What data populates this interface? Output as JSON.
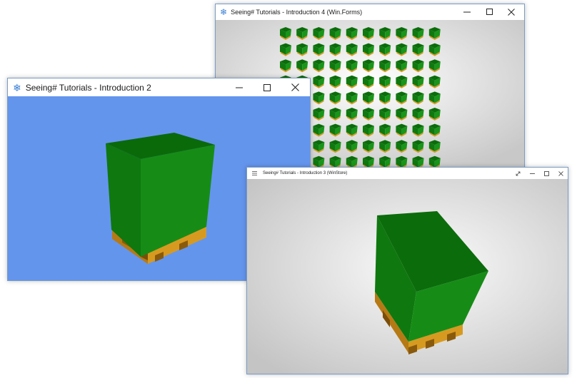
{
  "windows": {
    "winforms": {
      "title": "Seeing# Tutorials - Introduction 4 (Win.Forms)"
    },
    "intro2": {
      "title": "Seeing# Tutorials - Introduction 2"
    },
    "winstore": {
      "title": "Seeing# Tutorials - Introduction 3 (WinStore)"
    }
  },
  "icons": {
    "app": "snowflake-icon",
    "minimize": "minimize-icon",
    "maximize": "maximize-icon",
    "close": "close-icon",
    "menu": "hamburger-menu-icon",
    "fullscreen": "fullscreen-icon"
  },
  "colors": {
    "intro2_background": "#6495ed",
    "box_front": "#158a15",
    "box_top": "#1a9a1a",
    "box_side": "#0d6e0d",
    "pallet": "#d79a20"
  }
}
